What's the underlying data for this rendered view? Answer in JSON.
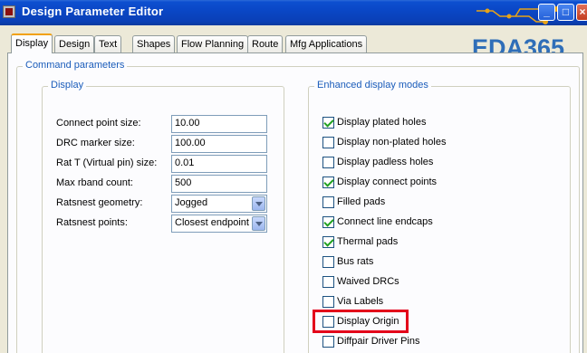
{
  "window": {
    "title": "Design Parameter Editor"
  },
  "watermark": {
    "text": "EDA365"
  },
  "tabs": [
    "Display",
    "Design",
    "Text",
    "Shapes",
    "Flow Planning",
    "Route",
    "Mfg Applications"
  ],
  "command_parameters": {
    "label": "Command parameters",
    "display_group": {
      "label": "Display",
      "fields": [
        {
          "label": "Connect point size:",
          "value": "10.00"
        },
        {
          "label": "DRC marker size:",
          "value": "100.00"
        },
        {
          "label": "Rat T (Virtual pin) size:",
          "value": "0.01"
        },
        {
          "label": "Max rband count:",
          "value": "500"
        },
        {
          "label": "Ratsnest geometry:",
          "value": "Jogged"
        },
        {
          "label": "Ratsnest points:",
          "value": "Closest endpoint"
        }
      ]
    },
    "enhanced_group": {
      "label": "Enhanced display modes",
      "options": [
        {
          "label": "Display plated holes",
          "checked": true
        },
        {
          "label": "Display non-plated holes",
          "checked": false
        },
        {
          "label": "Display padless holes",
          "checked": false
        },
        {
          "label": "Display connect points",
          "checked": true
        },
        {
          "label": "Filled pads",
          "checked": false
        },
        {
          "label": "Connect line endcaps",
          "checked": true
        },
        {
          "label": "Thermal pads",
          "checked": true
        },
        {
          "label": "Bus rats",
          "checked": false
        },
        {
          "label": "Waived DRCs",
          "checked": false
        },
        {
          "label": "Via Labels",
          "checked": false
        },
        {
          "label": "Display Origin",
          "checked": false
        },
        {
          "label": "Diffpair Driver Pins",
          "checked": false
        }
      ]
    }
  },
  "colors": {
    "title_bar": "#0a47c6",
    "group_label": "#1a5cba",
    "highlight": "#e3001a",
    "check": "#21a121",
    "logo": "#2f6eb8"
  }
}
